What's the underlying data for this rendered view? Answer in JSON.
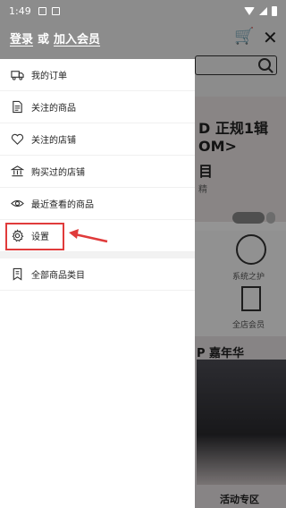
{
  "status_bar": {
    "time": "1:49"
  },
  "header": {
    "login_label": "登录",
    "or_label": "或",
    "join_label": "加入会员"
  },
  "background": {
    "headline_1": "D 正规1辑",
    "headline_2": "OM>",
    "headline_3": "目",
    "small_text": "精",
    "icon_label_1": "系统之护",
    "icon_label_2": "全店会员",
    "promo_title": "P 嘉年华",
    "promo_label": "活动专区"
  },
  "drawer": {
    "items": [
      {
        "label": "我的订单",
        "icon": "truck-icon"
      },
      {
        "label": "关注的商品",
        "icon": "document-icon"
      },
      {
        "label": "关注的店铺",
        "icon": "heart-icon"
      },
      {
        "label": "购买过的店铺",
        "icon": "bank-icon"
      },
      {
        "label": "最近查看的商品",
        "icon": "eye-icon"
      },
      {
        "label": "设置",
        "icon": "gear-icon"
      }
    ],
    "bottom_items": [
      {
        "label": "全部商品类目",
        "icon": "bookmark-icon"
      }
    ]
  },
  "colors": {
    "highlight": "#e03b3b",
    "overlay": "rgba(0,0,0,0.42)"
  }
}
